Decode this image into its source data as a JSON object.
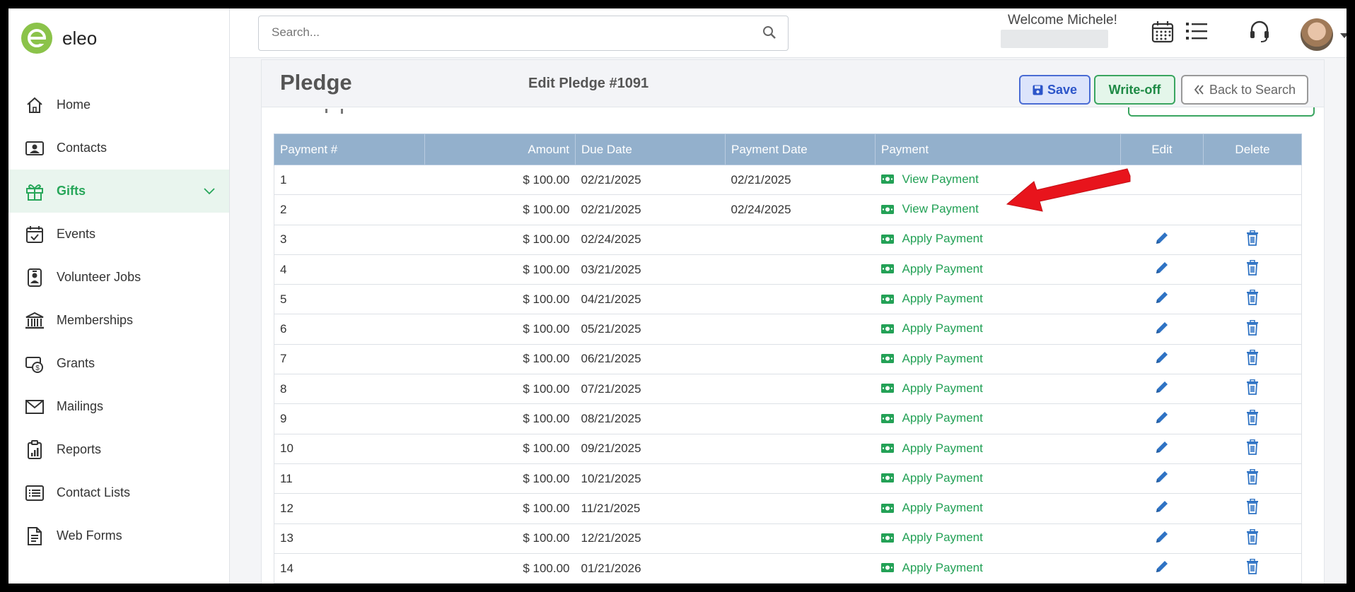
{
  "app": {
    "brand": "eleo"
  },
  "sidebar": {
    "items": [
      {
        "label": "Home",
        "icon": "home-icon"
      },
      {
        "label": "Contacts",
        "icon": "contact-card-icon"
      },
      {
        "label": "Gifts",
        "icon": "gift-icon",
        "active": true
      },
      {
        "label": "Events",
        "icon": "calendar-check-icon"
      },
      {
        "label": "Volunteer Jobs",
        "icon": "badge-icon"
      },
      {
        "label": "Memberships",
        "icon": "bank-icon"
      },
      {
        "label": "Grants",
        "icon": "money-icon"
      },
      {
        "label": "Mailings",
        "icon": "envelope-icon"
      },
      {
        "label": "Reports",
        "icon": "report-icon"
      },
      {
        "label": "Contact Lists",
        "icon": "list-icon"
      },
      {
        "label": "Web Forms",
        "icon": "form-icon"
      }
    ]
  },
  "header": {
    "search_placeholder": "Search...",
    "welcome": "Welcome Michele!"
  },
  "page": {
    "title": "Pledge",
    "subtitle": "Edit Pledge #1091",
    "buttons": {
      "save": "Save",
      "writeoff": "Write-off",
      "back": "Back to Search"
    }
  },
  "table": {
    "columns": [
      "Payment #",
      "Amount",
      "Due Date",
      "Payment Date",
      "Payment",
      "Edit",
      "Delete"
    ],
    "rows": [
      {
        "num": "1",
        "amount": "$ 100.00",
        "due": "02/21/2025",
        "paid": "02/21/2025",
        "action": "View Payment",
        "editable": false
      },
      {
        "num": "2",
        "amount": "$ 100.00",
        "due": "02/21/2025",
        "paid": "02/24/2025",
        "action": "View Payment",
        "editable": false
      },
      {
        "num": "3",
        "amount": "$ 100.00",
        "due": "02/24/2025",
        "paid": "",
        "action": "Apply Payment",
        "editable": true
      },
      {
        "num": "4",
        "amount": "$ 100.00",
        "due": "03/21/2025",
        "paid": "",
        "action": "Apply Payment",
        "editable": true
      },
      {
        "num": "5",
        "amount": "$ 100.00",
        "due": "04/21/2025",
        "paid": "",
        "action": "Apply Payment",
        "editable": true
      },
      {
        "num": "6",
        "amount": "$ 100.00",
        "due": "05/21/2025",
        "paid": "",
        "action": "Apply Payment",
        "editable": true
      },
      {
        "num": "7",
        "amount": "$ 100.00",
        "due": "06/21/2025",
        "paid": "",
        "action": "Apply Payment",
        "editable": true
      },
      {
        "num": "8",
        "amount": "$ 100.00",
        "due": "07/21/2025",
        "paid": "",
        "action": "Apply Payment",
        "editable": true
      },
      {
        "num": "9",
        "amount": "$ 100.00",
        "due": "08/21/2025",
        "paid": "",
        "action": "Apply Payment",
        "editable": true
      },
      {
        "num": "10",
        "amount": "$ 100.00",
        "due": "09/21/2025",
        "paid": "",
        "action": "Apply Payment",
        "editable": true
      },
      {
        "num": "11",
        "amount": "$ 100.00",
        "due": "10/21/2025",
        "paid": "",
        "action": "Apply Payment",
        "editable": true
      },
      {
        "num": "12",
        "amount": "$ 100.00",
        "due": "11/21/2025",
        "paid": "",
        "action": "Apply Payment",
        "editable": true
      },
      {
        "num": "13",
        "amount": "$ 100.00",
        "due": "12/21/2025",
        "paid": "",
        "action": "Apply Payment",
        "editable": true
      },
      {
        "num": "14",
        "amount": "$ 100.00",
        "due": "01/21/2026",
        "paid": "",
        "action": "Apply Payment",
        "editable": true
      }
    ]
  },
  "colors": {
    "accent_green": "#23a156",
    "header_blue": "#93b0cc",
    "icon_blue": "#2f73c4",
    "arrow_red": "#e8141c"
  }
}
